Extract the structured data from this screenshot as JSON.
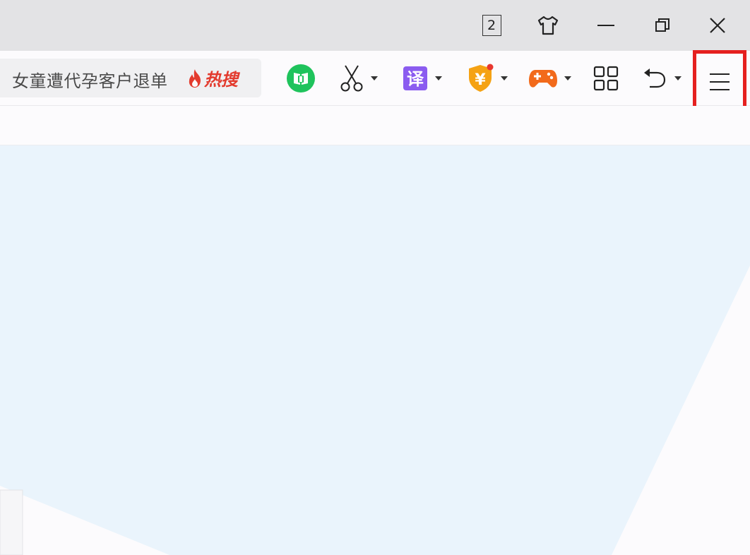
{
  "titlebar": {
    "tab_count": "2",
    "icons": [
      "skin-icon",
      "minimize-icon",
      "restore-icon",
      "close-icon"
    ]
  },
  "search": {
    "text": "女童遭代孕客户退单",
    "hot_label": "热搜",
    "hot_icon": "flame-icon"
  },
  "toolbar": {
    "items": [
      {
        "name": "reader",
        "icon": "book-icon",
        "color": "#1fc35c"
      },
      {
        "name": "screenshot",
        "icon": "scissors-icon",
        "color": "#222222"
      },
      {
        "name": "translate",
        "icon": "translate-icon",
        "label": "译",
        "color": "#8b5cf0"
      },
      {
        "name": "payment-shield",
        "icon": "yuan-shield-icon",
        "label": "¥",
        "color": "#f5a213"
      },
      {
        "name": "games",
        "icon": "gamepad-icon",
        "color": "#f26a1b"
      },
      {
        "name": "apps",
        "icon": "grid-icon",
        "color": "#222222"
      },
      {
        "name": "undo",
        "icon": "undo-icon",
        "color": "#222222"
      },
      {
        "name": "main-menu",
        "icon": "hamburger-menu-icon",
        "color": "#222222"
      }
    ],
    "highlight_color": "#e5201f"
  },
  "colors": {
    "titlebar_bg": "#e3e3e5",
    "toolbar_bg": "#fcfbfd",
    "content_bg": "#eaf4fc"
  }
}
